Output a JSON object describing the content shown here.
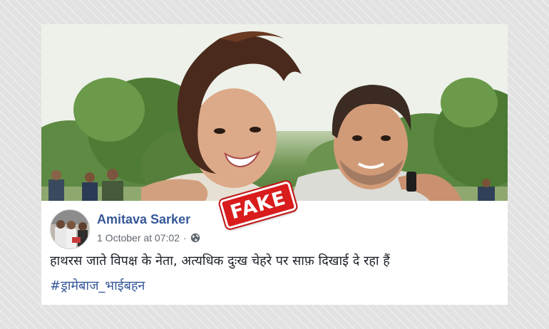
{
  "stamp": {
    "label": "FAKE",
    "color": "#d91c1c"
  },
  "post": {
    "author_name": "Amitava Sarker",
    "timestamp": "1 October at 07:02",
    "separator": "·",
    "privacy_icon": "globe-icon",
    "text": "हाथरस जाते विपक्ष के नेता, अत्यधिक दुःख चेहरे पर साफ़ दिखाई दे रहा हैं",
    "hashtag": "#ड्रामेबाज_भाईबहन",
    "link_color": "#365899"
  }
}
